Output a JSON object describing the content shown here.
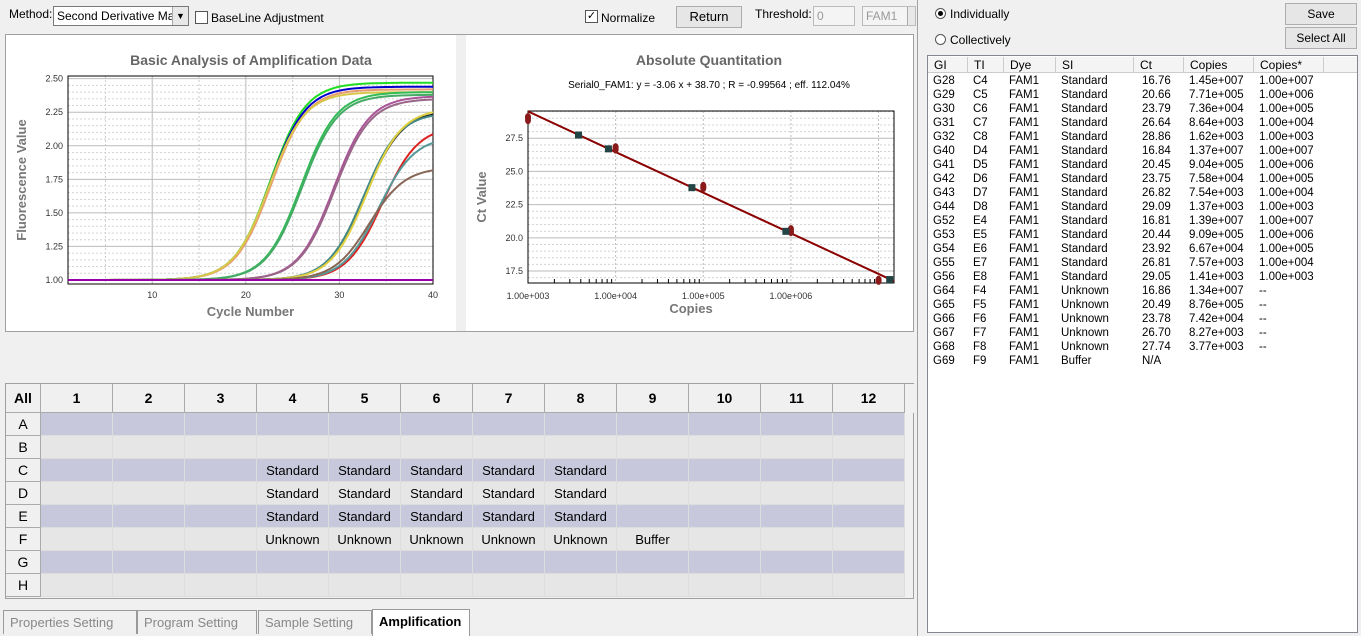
{
  "toolbar": {
    "method_label": "Method:",
    "method_value": "Second Derivative Maxin",
    "baseline_label": "BaseLine Adjustment",
    "baseline_checked": false,
    "normalize_label": "Normalize",
    "normalize_checked": true,
    "return_label": "Return",
    "threshold_label": "Threshold:",
    "threshold_value": "0",
    "dye_value": "FAM1"
  },
  "chart_data": [
    {
      "type": "line",
      "title": "Basic Analysis of Amplification Data",
      "xlabel": "Cycle Number",
      "ylabel": "Fluorescence Value",
      "xlim": [
        1,
        40
      ],
      "ylim": [
        0.97,
        2.52
      ],
      "xticks": [
        "10",
        "20",
        "30",
        "40"
      ],
      "yticks": [
        "1.00",
        "1.25",
        "1.50",
        "1.75",
        "2.00",
        "2.25",
        "2.50"
      ],
      "grid": true,
      "series": [
        {
          "color": "#22dd22",
          "midpoint": 22.6,
          "plateau": 2.47
        },
        {
          "color": "#0000cc",
          "midpoint": 22.6,
          "plateau": 2.44
        },
        {
          "color": "#e89a70",
          "midpoint": 22.7,
          "plateau": 2.42
        },
        {
          "color": "#d8c84a",
          "midpoint": 22.5,
          "plateau": 2.4
        },
        {
          "color": "#33bb55",
          "midpoint": 25.9,
          "plateau": 2.4
        },
        {
          "color": "#44aa66",
          "midpoint": 26.0,
          "plateau": 2.38
        },
        {
          "color": "#aa5599",
          "midpoint": 29.4,
          "plateau": 2.37
        },
        {
          "color": "#996688",
          "midpoint": 29.5,
          "plateau": 2.35
        },
        {
          "color": "#111111",
          "midpoint": 32.8,
          "plateau": 2.26
        },
        {
          "color": "#448888",
          "midpoint": 32.6,
          "plateau": 2.25
        },
        {
          "color": "#e0d040",
          "midpoint": 32.9,
          "plateau": 2.28
        },
        {
          "color": "#dd2222",
          "midpoint": 34.6,
          "plateau": 2.15
        },
        {
          "color": "#559999",
          "midpoint": 34.2,
          "plateau": 2.07
        },
        {
          "color": "#886655",
          "midpoint": 33.2,
          "plateau": 1.84
        },
        {
          "color": "#9900aa",
          "midpoint": null,
          "plateau": 1.0
        }
      ]
    },
    {
      "type": "scatter",
      "title": "Absolute Quantitation",
      "subtitle": "Serial0_FAM1: y = -3.06 x + 38.70 ; R = -0.99564 ;  eff. 112.04%",
      "xlabel": "Copies",
      "ylabel": "Ct Value",
      "xscale": "log",
      "xlim": [
        1000,
        15000000
      ],
      "ylim": [
        16.6,
        29.55
      ],
      "xticks": [
        "1.00e+003",
        "1.00e+004",
        "1.00e+005",
        "1.00e+006"
      ],
      "yticks": [
        "17.5",
        "20.0",
        "22.5",
        "25.0",
        "27.5"
      ],
      "grid": true,
      "fit": {
        "slope": -3.06,
        "intercept": 38.7,
        "color": "#8b0000"
      },
      "standards": {
        "color": "#8b1a1a",
        "marker": "circle",
        "points": [
          [
            10000000,
            16.76
          ],
          [
            1000000,
            20.66
          ],
          [
            100000,
            23.79
          ],
          [
            10000,
            26.64
          ],
          [
            1000,
            28.86
          ],
          [
            10000000,
            16.84
          ],
          [
            1000000,
            20.45
          ],
          [
            100000,
            23.75
          ],
          [
            10000,
            26.82
          ],
          [
            1000,
            29.09
          ],
          [
            10000000,
            16.81
          ],
          [
            1000000,
            20.44
          ],
          [
            100000,
            23.92
          ],
          [
            10000,
            26.81
          ],
          [
            1000,
            29.05
          ]
        ]
      },
      "unknowns": {
        "color": "#224444",
        "marker": "square",
        "points": [
          [
            13400000,
            16.86
          ],
          [
            876000,
            20.49
          ],
          [
            74200,
            23.78
          ],
          [
            8270,
            26.7
          ],
          [
            3770,
            27.74
          ]
        ]
      }
    }
  ],
  "plate": {
    "corner": "All",
    "columns": [
      "1",
      "2",
      "3",
      "4",
      "5",
      "6",
      "7",
      "8",
      "9",
      "10",
      "11",
      "12"
    ],
    "rows": [
      {
        "label": "A",
        "cells": [
          "",
          "",
          "",
          "",
          "",
          "",
          "",
          "",
          "",
          "",
          "",
          ""
        ]
      },
      {
        "label": "B",
        "cells": [
          "",
          "",
          "",
          "",
          "",
          "",
          "",
          "",
          "",
          "",
          "",
          ""
        ]
      },
      {
        "label": "C",
        "cells": [
          "",
          "",
          "",
          "Standard",
          "Standard",
          "Standard",
          "Standard",
          "Standard",
          "",
          "",
          "",
          ""
        ]
      },
      {
        "label": "D",
        "cells": [
          "",
          "",
          "",
          "Standard",
          "Standard",
          "Standard",
          "Standard",
          "Standard",
          "",
          "",
          "",
          ""
        ]
      },
      {
        "label": "E",
        "cells": [
          "",
          "",
          "",
          "Standard",
          "Standard",
          "Standard",
          "Standard",
          "Standard",
          "",
          "",
          "",
          ""
        ]
      },
      {
        "label": "F",
        "cells": [
          "",
          "",
          "",
          "Unknown",
          "Unknown",
          "Unknown",
          "Unknown",
          "Unknown",
          "Buffer",
          "",
          "",
          ""
        ]
      },
      {
        "label": "G",
        "cells": [
          "",
          "",
          "",
          "",
          "",
          "",
          "",
          "",
          "",
          "",
          "",
          ""
        ]
      },
      {
        "label": "H",
        "cells": [
          "",
          "",
          "",
          "",
          "",
          "",
          "",
          "",
          "",
          "",
          "",
          ""
        ]
      }
    ],
    "colors": {
      "odd": "#c8c8dc",
      "even": "#e6e6e6"
    }
  },
  "tabs": [
    {
      "label": "Properties Setting",
      "active": false
    },
    {
      "label": "Program Setting",
      "active": false
    },
    {
      "label": "Sample Setting",
      "active": false
    },
    {
      "label": "Amplification",
      "active": true
    }
  ],
  "right": {
    "individually_label": "Individually",
    "collectively_label": "Collectively",
    "mode": "Individually",
    "save_label": "Save",
    "select_all_label": "Select All"
  },
  "results": {
    "columns": [
      "GI",
      "TI",
      "Dye",
      "SI",
      "Ct",
      "Copies",
      "Copies*"
    ],
    "rows": [
      [
        "G28",
        "C4",
        "FAM1",
        "Standard",
        "16.76",
        "1.45e+007",
        "1.00e+007"
      ],
      [
        "G29",
        "C5",
        "FAM1",
        "Standard",
        "20.66",
        "7.71e+005",
        "1.00e+006"
      ],
      [
        "G30",
        "C6",
        "FAM1",
        "Standard",
        "23.79",
        "7.36e+004",
        "1.00e+005"
      ],
      [
        "G31",
        "C7",
        "FAM1",
        "Standard",
        "26.64",
        "8.64e+003",
        "1.00e+004"
      ],
      [
        "G32",
        "C8",
        "FAM1",
        "Standard",
        "28.86",
        "1.62e+003",
        "1.00e+003"
      ],
      [
        "G40",
        "D4",
        "FAM1",
        "Standard",
        "16.84",
        "1.37e+007",
        "1.00e+007"
      ],
      [
        "G41",
        "D5",
        "FAM1",
        "Standard",
        "20.45",
        "9.04e+005",
        "1.00e+006"
      ],
      [
        "G42",
        "D6",
        "FAM1",
        "Standard",
        "23.75",
        "7.58e+004",
        "1.00e+005"
      ],
      [
        "G43",
        "D7",
        "FAM1",
        "Standard",
        "26.82",
        "7.54e+003",
        "1.00e+004"
      ],
      [
        "G44",
        "D8",
        "FAM1",
        "Standard",
        "29.09",
        "1.37e+003",
        "1.00e+003"
      ],
      [
        "G52",
        "E4",
        "FAM1",
        "Standard",
        "16.81",
        "1.39e+007",
        "1.00e+007"
      ],
      [
        "G53",
        "E5",
        "FAM1",
        "Standard",
        "20.44",
        "9.09e+005",
        "1.00e+006"
      ],
      [
        "G54",
        "E6",
        "FAM1",
        "Standard",
        "23.92",
        "6.67e+004",
        "1.00e+005"
      ],
      [
        "G55",
        "E7",
        "FAM1",
        "Standard",
        "26.81",
        "7.57e+003",
        "1.00e+004"
      ],
      [
        "G56",
        "E8",
        "FAM1",
        "Standard",
        "29.05",
        "1.41e+003",
        "1.00e+003"
      ],
      [
        "G64",
        "F4",
        "FAM1",
        "Unknown",
        "16.86",
        "1.34e+007",
        "--"
      ],
      [
        "G65",
        "F5",
        "FAM1",
        "Unknown",
        "20.49",
        "8.76e+005",
        "--"
      ],
      [
        "G66",
        "F6",
        "FAM1",
        "Unknown",
        "23.78",
        "7.42e+004",
        "--"
      ],
      [
        "G67",
        "F7",
        "FAM1",
        "Unknown",
        "26.70",
        "8.27e+003",
        "--"
      ],
      [
        "G68",
        "F8",
        "FAM1",
        "Unknown",
        "27.74",
        "3.77e+003",
        "--"
      ],
      [
        "G69",
        "F9",
        "FAM1",
        "Buffer",
        "N/A",
        "",
        ""
      ]
    ]
  }
}
